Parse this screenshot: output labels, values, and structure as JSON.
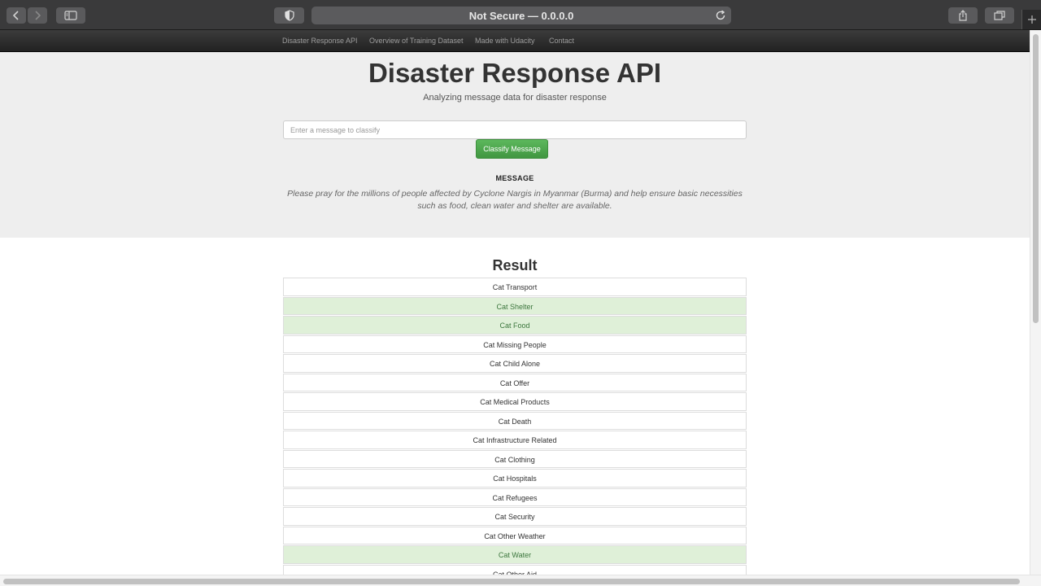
{
  "browser": {
    "address_text": "Not Secure — 0.0.0.0"
  },
  "navbar": {
    "brand": "Disaster Response API",
    "links": [
      "Overview of Training Dataset",
      "Made with Udacity",
      "Contact"
    ]
  },
  "header": {
    "title": "Disaster Response API",
    "subtitle": "Analyzing message data for disaster response"
  },
  "form": {
    "placeholder": "Enter a message to classify",
    "button_label": "Classify Message"
  },
  "message": {
    "heading": "MESSAGE",
    "text": "Please pray for the millions of people affected by Cyclone Nargis in Myanmar (Burma) and help ensure basic necessities such as food, clean water and shelter are available."
  },
  "result": {
    "title": "Result",
    "items": [
      {
        "label": "Cat Transport",
        "positive": false
      },
      {
        "label": "Cat Shelter",
        "positive": true
      },
      {
        "label": "Cat Food",
        "positive": true
      },
      {
        "label": "Cat Missing People",
        "positive": false
      },
      {
        "label": "Cat Child Alone",
        "positive": false
      },
      {
        "label": "Cat Offer",
        "positive": false
      },
      {
        "label": "Cat Medical Products",
        "positive": false
      },
      {
        "label": "Cat Death",
        "positive": false
      },
      {
        "label": "Cat Infrastructure Related",
        "positive": false
      },
      {
        "label": "Cat Clothing",
        "positive": false
      },
      {
        "label": "Cat Hospitals",
        "positive": false
      },
      {
        "label": "Cat Refugees",
        "positive": false
      },
      {
        "label": "Cat Security",
        "positive": false
      },
      {
        "label": "Cat Other Weather",
        "positive": false
      },
      {
        "label": "Cat Water",
        "positive": true
      },
      {
        "label": "Cat Other Aid",
        "positive": false
      }
    ]
  }
}
